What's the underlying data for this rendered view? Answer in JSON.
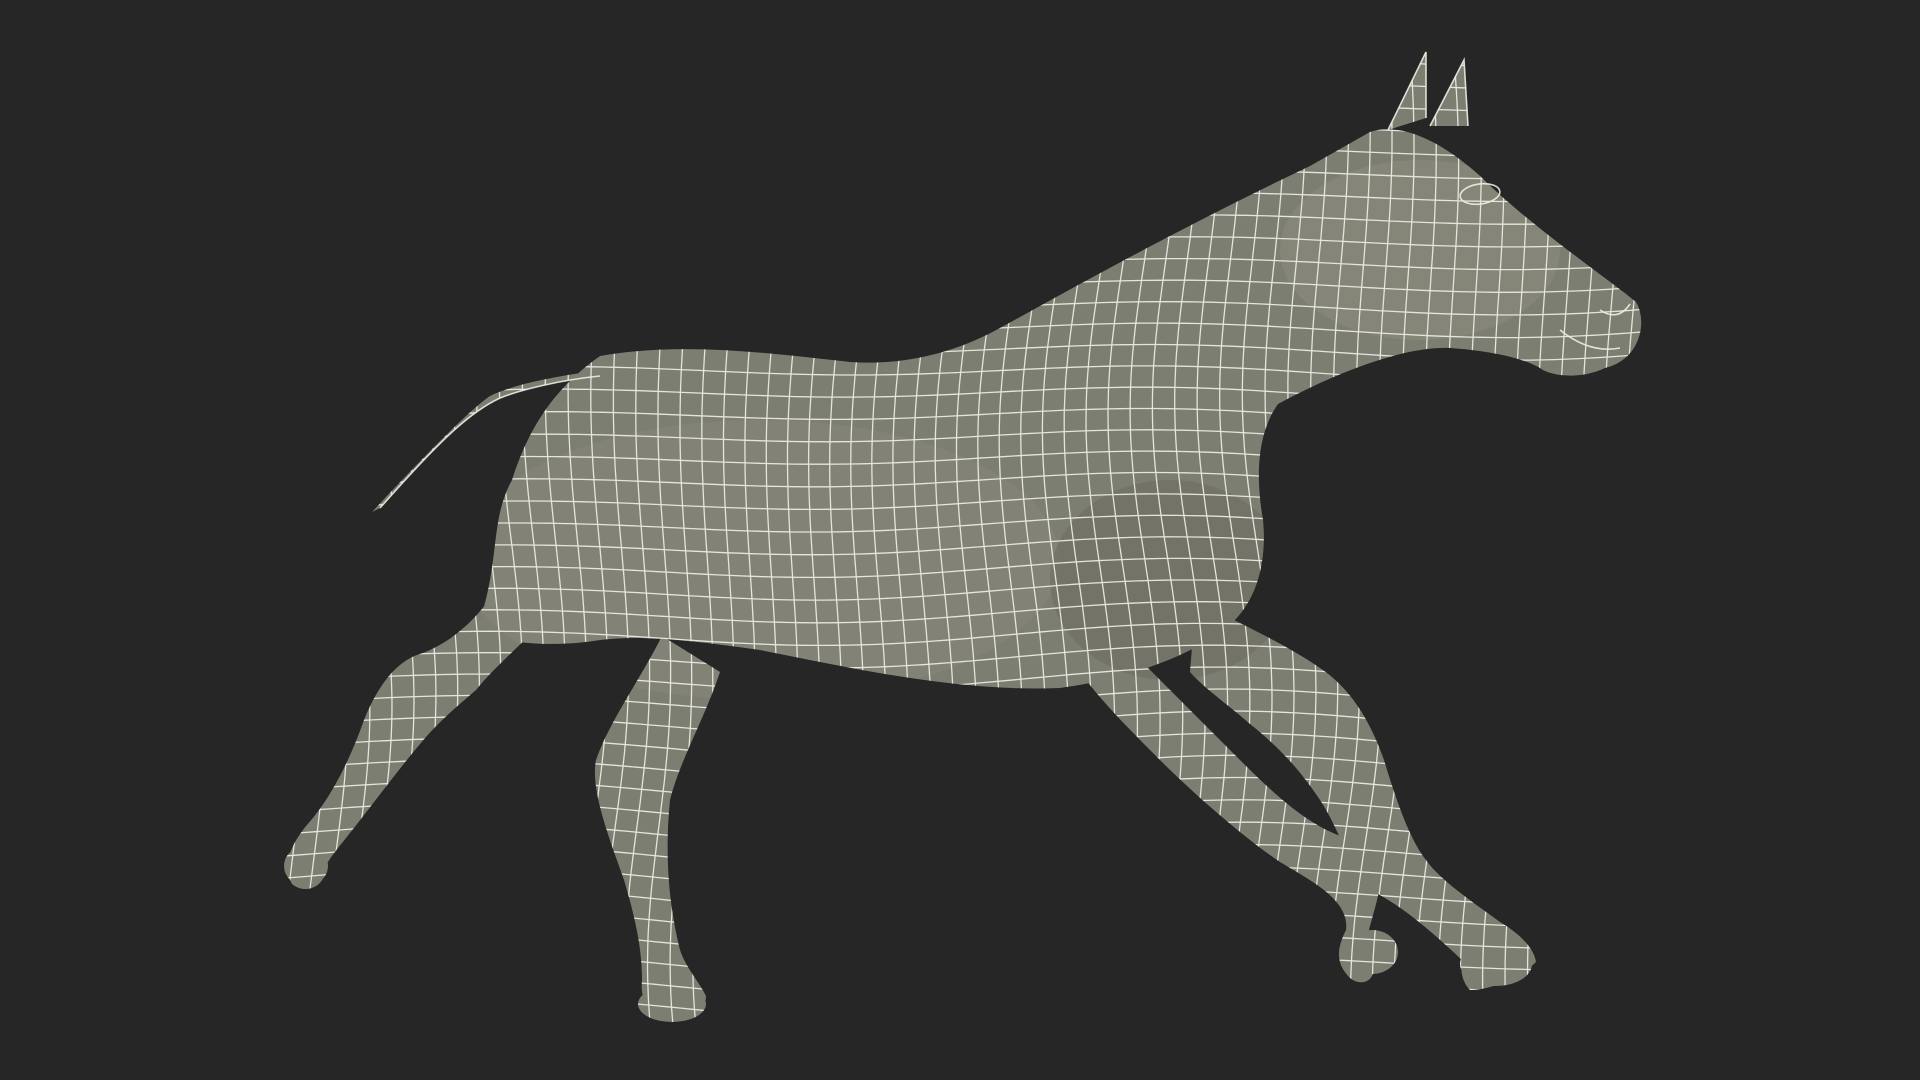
{
  "scene": {
    "subject": "horse-wireframe-model",
    "icon": "horse-icon"
  },
  "colors": {
    "background": "#262626",
    "mesh_fill": "#7d7e72",
    "mesh_shade": "#6c6d62",
    "wire": "#eeeee4"
  }
}
